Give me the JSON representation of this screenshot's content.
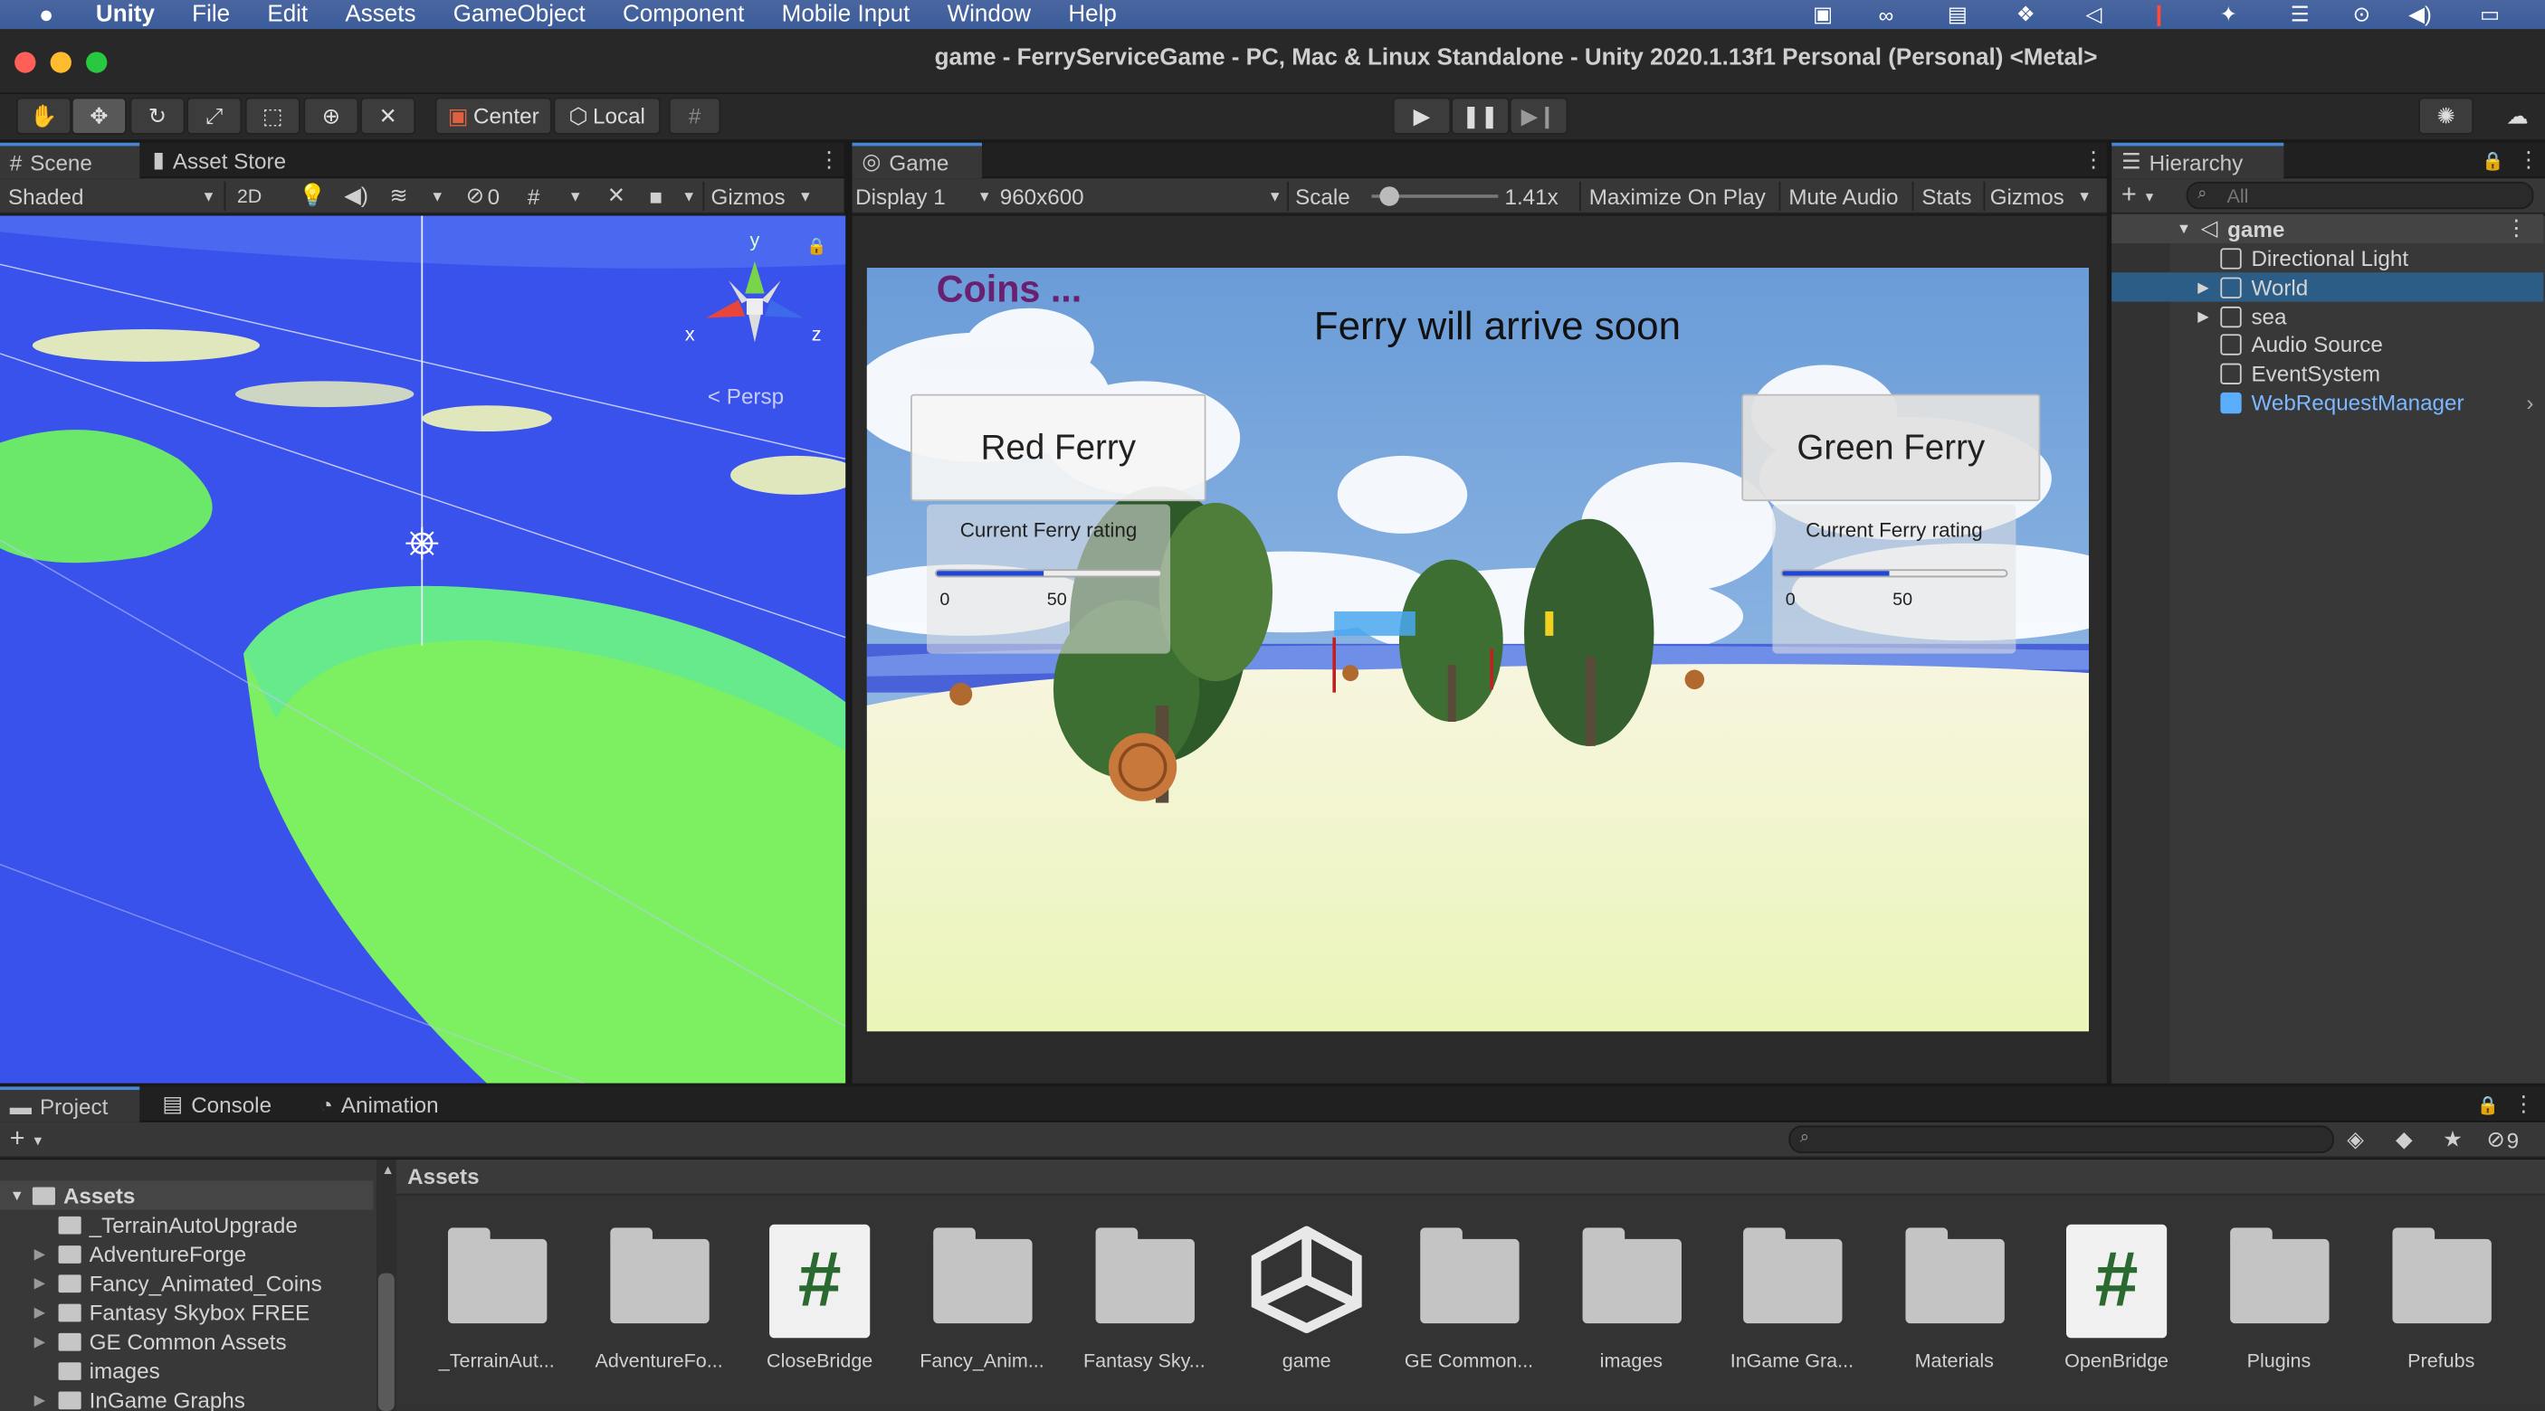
{
  "menubar": {
    "app": "Unity",
    "items": [
      "File",
      "Edit",
      "Assets",
      "GameObject",
      "Component",
      "Mobile Input",
      "Window",
      "Help"
    ]
  },
  "window": {
    "title": "game - FerryServiceGame - PC, Mac & Linux Standalone - Unity 2020.1.13f1 Personal (Personal) <Metal>"
  },
  "toolbar": {
    "pivot": "Center",
    "space": "Local"
  },
  "scene": {
    "tabs": [
      "Scene",
      "Asset Store"
    ],
    "shading": "Shaded",
    "mode2d": "2D",
    "hidden_count": "0",
    "gizmos": "Gizmos",
    "persp": "Persp",
    "axis_x": "x",
    "axis_y": "y",
    "axis_z": "z"
  },
  "game": {
    "tab": "Game",
    "display": "Display 1",
    "resolution": "960x600",
    "scale_label": "Scale",
    "scale_value": "1.41x",
    "maximize": "Maximize On Play",
    "mute": "Mute Audio",
    "stats": "Stats",
    "gizmos": "Gizmos",
    "hud": {
      "coins": "Coins ...",
      "status": "Ferry will arrive soon",
      "red": {
        "button": "Red Ferry",
        "rating_label": "Current Ferry rating",
        "min": "0",
        "value_label": "50",
        "fill": 0.48
      },
      "green": {
        "button": "Green Ferry",
        "rating_label": "Current Ferry rating",
        "min": "0",
        "value_label": "50",
        "fill": 0.48
      }
    }
  },
  "hierarchy": {
    "tab": "Hierarchy",
    "search_placeholder": "All",
    "root": "game",
    "items": [
      "Directional Light",
      "World",
      "sea",
      "Audio Source",
      "EventSystem",
      "WebRequestManager"
    ]
  },
  "bottom": {
    "tabs": [
      "Project",
      "Console",
      "Animation"
    ],
    "hidden_count": "9",
    "tree_root": "Assets",
    "tree": [
      "_TerrainAutoUpgrade",
      "AdventureForge",
      "Fancy_Animated_Coins",
      "Fantasy Skybox FREE",
      "GE Common Assets",
      "images",
      "InGame Graphs"
    ],
    "breadcrumb": "Assets",
    "assets": [
      "_TerrainAut...",
      "AdventureFo...",
      "CloseBridge",
      "Fancy_Anim...",
      "Fantasy Sky...",
      "game",
      "GE Common...",
      "images",
      "InGame Gra...",
      "Materials",
      "OpenBridge",
      "Plugins",
      "Prefubs"
    ]
  },
  "colors": {
    "accent": "#4a86d8",
    "selection": "#2c5d87",
    "prefab": "#7cb8ff"
  }
}
